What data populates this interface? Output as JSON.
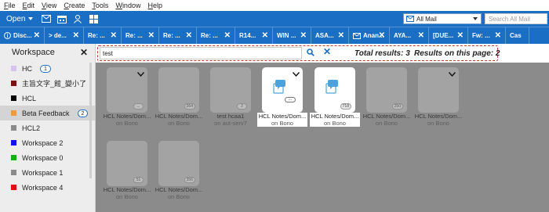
{
  "menu": [
    "File",
    "Edit",
    "View",
    "Create",
    "Tools",
    "Window",
    "Help"
  ],
  "toolbar": {
    "open_label": "Open",
    "mail_select_value": "All Mail",
    "search_placeholder": "Search All Mail"
  },
  "tabs": [
    {
      "label": "Disc...",
      "icon": "info-icon"
    },
    {
      "label": "> de...",
      "icon": ""
    },
    {
      "label": "Re: ...",
      "icon": ""
    },
    {
      "label": "Re: ...",
      "icon": ""
    },
    {
      "label": "Re: ...",
      "icon": ""
    },
    {
      "label": "Re: ...",
      "icon": ""
    },
    {
      "label": "R14...",
      "icon": ""
    },
    {
      "label": "WIN ...",
      "icon": ""
    },
    {
      "label": "ASA...",
      "icon": ""
    },
    {
      "label": "Anan...",
      "icon": "mail-icon"
    },
    {
      "label": "AYA...",
      "icon": ""
    },
    {
      "label": "[DUE...",
      "icon": ""
    },
    {
      "label": "Fw: ...",
      "icon": ""
    },
    {
      "label": "Cas",
      "icon": ""
    }
  ],
  "sidebar": {
    "title": "Workspace",
    "items": [
      {
        "label": "HC",
        "color": "#d9c2f0",
        "badge": "1"
      },
      {
        "label": "主旨文字_館_變小了",
        "color": "#7a1010",
        "badge": ""
      },
      {
        "label": "HCL",
        "color": "#000000",
        "badge": ""
      },
      {
        "label": "Beta Feedback",
        "color": "#f39a3c",
        "badge": "2"
      },
      {
        "label": "HCL2",
        "color": "#8a8a8a",
        "badge": ""
      },
      {
        "label": "Workspace 2",
        "color": "#1010f0",
        "badge": ""
      },
      {
        "label": "Workspace 0",
        "color": "#10b010",
        "badge": ""
      },
      {
        "label": "Workspace 1",
        "color": "#8a8a8a",
        "badge": ""
      },
      {
        "label": "Workspace 4",
        "color": "#e01010",
        "badge": ""
      }
    ]
  },
  "filter": {
    "value": "test",
    "total_results": "Total results: 3",
    "page_results": "Results on this page: 2"
  },
  "cards": [
    {
      "title": "",
      "subtitle": "",
      "badge": "...",
      "highlighted": false,
      "chevron": true
    },
    {
      "title": "",
      "subtitle": "",
      "badge": "264",
      "highlighted": false,
      "chevron": false
    },
    {
      "title": "",
      "subtitle": "",
      "badge": "2",
      "highlighted": false,
      "chevron": false
    },
    {
      "title": "HCL Notes/Dom...",
      "subtitle": "on Bono",
      "badge": "",
      "highlighted": true,
      "chevron": true,
      "ellipsis": "..."
    },
    {
      "title": "HCL Notes/Dom...",
      "subtitle": "on Bono",
      "badge": "718",
      "highlighted": true,
      "chevron": false
    },
    {
      "title": "",
      "subtitle": "",
      "badge": "250",
      "highlighted": false,
      "chevron": false
    },
    {
      "title": "",
      "subtitle": "",
      "badge": "",
      "highlighted": false,
      "chevron": true
    },
    {
      "title": "",
      "subtitle": "",
      "badge": "51",
      "highlighted": false,
      "chevron": false
    },
    {
      "title": "",
      "subtitle": "",
      "badge": "356",
      "highlighted": false,
      "chevron": false
    }
  ],
  "card_labels": [
    {
      "title": "HCL Notes/Dom...",
      "subtitle": "on Bono"
    },
    {
      "title": "HCL Notes/Dom...",
      "subtitle": "on Bono"
    },
    {
      "title": "test hcaa1",
      "subtitle": "on aut-serv7"
    },
    {
      "title": "HCL Notes/Dom...",
      "subtitle": "on Bono"
    },
    {
      "title": "HCL Notes/Dom...",
      "subtitle": "on Bono"
    },
    {
      "title": "HCL Notes/Dom...",
      "subtitle": "on Bono"
    },
    {
      "title": "HCL Notes/Dom...",
      "subtitle": "on Bono"
    },
    {
      "title": "HCL Notes/Dom...",
      "subtitle": "on Bono"
    },
    {
      "title": "HCL Notes/Dom...",
      "subtitle": "on Bono"
    }
  ]
}
